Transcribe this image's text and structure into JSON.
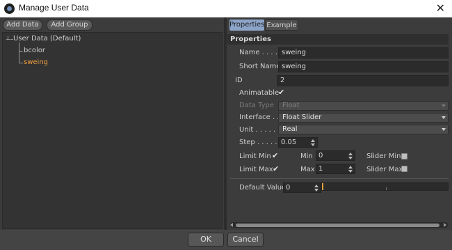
{
  "window": {
    "title": "Manage User Data"
  },
  "left_toolbar": {
    "add_data_label": "Add Data",
    "add_group_label": "Add Group"
  },
  "tree": {
    "root_label": "User Data (Default)",
    "children": [
      {
        "label": "bcolor",
        "color": "#cfcfcf"
      },
      {
        "label": "sweing",
        "color": "#f0a040"
      }
    ]
  },
  "tabs": [
    {
      "label": "Properties",
      "active": true
    },
    {
      "label": "Example",
      "active": false
    }
  ],
  "properties": {
    "section_title": "Properties",
    "name_label": "Name . . . . .",
    "name_value": "sweing",
    "short_name_label": "Short Name",
    "short_name_value": "sweing",
    "id_label": "ID",
    "id_value": "2",
    "animatable_label": "Animatable",
    "animatable_checked": "✔",
    "data_type_label": "Data Type",
    "data_type_value": "Float",
    "interface_label": "Interface . .",
    "interface_value": "Float Slider",
    "unit_label": "Unit . . . . . .",
    "unit_value": "Real",
    "step_label": "Step . . . . . .",
    "step_value": "0.05",
    "limit_min_label": "Limit Min",
    "limit_min_checked": "✔",
    "min_label": "Min",
    "min_value": "0",
    "slider_min_label": "Slider Min",
    "limit_max_label": "Limit Max",
    "limit_max_checked": "✔",
    "max_label": "Max",
    "max_value": "1",
    "slider_max_label": "Slider Max",
    "default_value_label": "Default Value",
    "default_value": "0",
    "default_slider_fraction": 0
  },
  "buttons": {
    "ok_label": "OK",
    "cancel_label": "Cancel"
  },
  "colors": {
    "accent_tab": "#8ca4c8",
    "tree_selected": "#f0a040",
    "slider_marker": "#f0a040",
    "background": "#3c3c3c"
  }
}
